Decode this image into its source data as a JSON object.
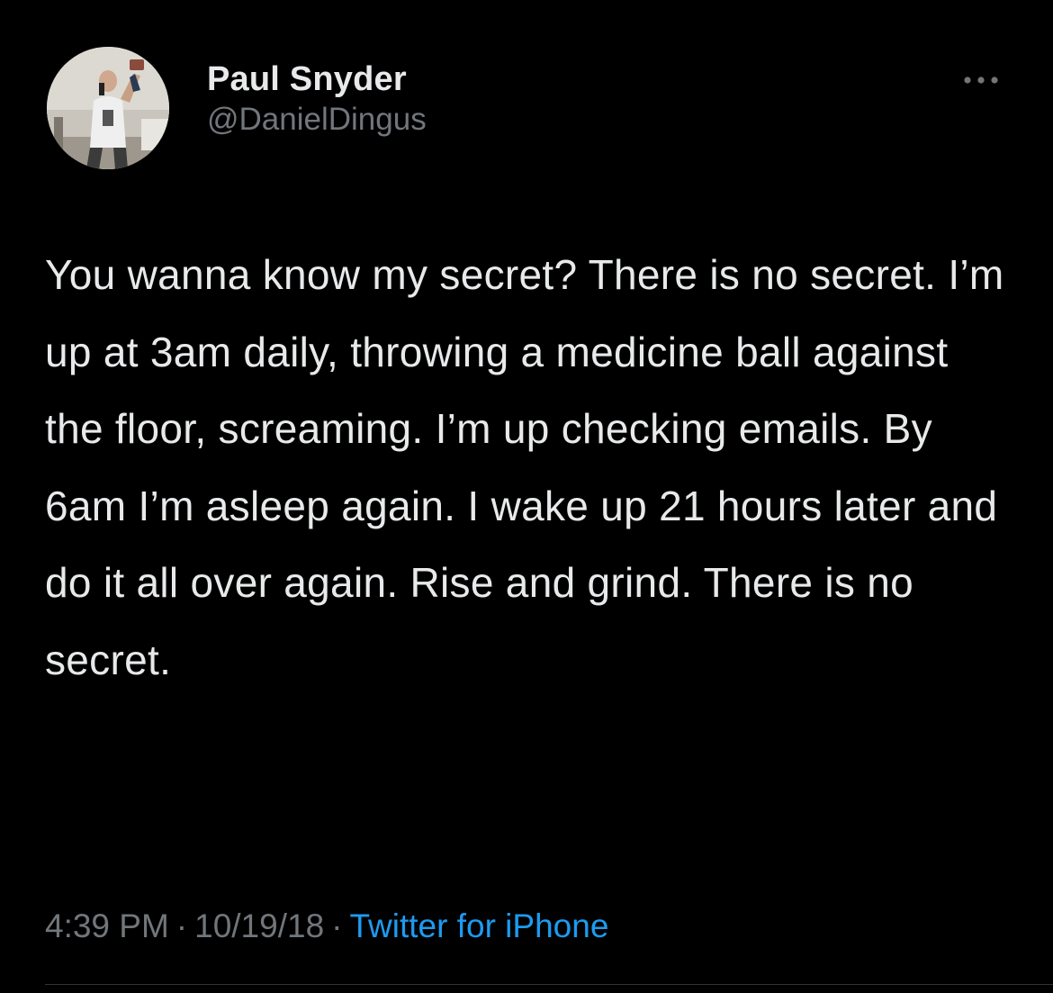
{
  "tweet": {
    "author": {
      "display_name": "Paul Snyder",
      "handle": "@DanielDingus",
      "avatar_icon": "profile-photo"
    },
    "more_icon": "more-horizontal-icon",
    "text": "You wanna know my secret? There is no secret. I’m up at 3am daily, throwing a medicine ball against the floor, screaming. I’m up checking emails. By 6am I’m asleep again. I wake up 21 hours later and do it all over again. Rise and grind. There is no secret.",
    "time": "4:39 PM",
    "date": "10/19/18",
    "separator": "·",
    "source": "Twitter for iPhone"
  },
  "colors": {
    "background": "#000000",
    "primary_text": "#e7e9ea",
    "secondary_text": "#71767b",
    "link": "#1d9bf0",
    "divider": "#2f3336"
  }
}
